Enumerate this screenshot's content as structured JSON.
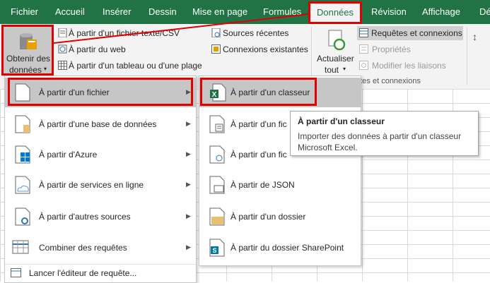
{
  "tabs": [
    "Fichier",
    "Accueil",
    "Insérer",
    "Dessin",
    "Mise en page",
    "Formules",
    "Données",
    "Révision",
    "Affichage",
    "Dév"
  ],
  "ribbon": {
    "obtenir_line1": "Obtenir des",
    "obtenir_line2": "données",
    "from_text_csv": "À partir d'un fichier texte/CSV",
    "from_web": "À partir du web",
    "from_table": "À partir d'un tableau ou d'une plage",
    "recent_sources": "Sources récentes",
    "existing_connections": "Connexions existantes",
    "refresh_line1": "Actualiser",
    "refresh_line2": "tout",
    "queries_connections": "Requêtes et connexions",
    "properties": "Propriétés",
    "edit_links": "Modifier les liaisons",
    "group_label": "uêtes et connexions"
  },
  "menu1": {
    "items": [
      {
        "label": "À partir d'un fichier"
      },
      {
        "label": "À partir d'une base de données"
      },
      {
        "label": "À partir d'Azure"
      },
      {
        "label": "À partir de services en ligne"
      },
      {
        "label": "À partir d'autres sources"
      },
      {
        "label": "Combiner des requêtes"
      }
    ],
    "footer": "Lancer l'éditeur de requête..."
  },
  "menu2": {
    "items": [
      {
        "label": "À partir d'un classeur"
      },
      {
        "label": "À partir d'un fic"
      },
      {
        "label": "À partir d'un fic"
      },
      {
        "label": "À partir de JSON"
      },
      {
        "label": "À partir d'un dossier"
      },
      {
        "label": "À partir du dossier SharePoint"
      }
    ]
  },
  "tooltip": {
    "title": "À partir d'un classeur",
    "body_line1": "Importer des données à partir d'un classeur",
    "body_line2": "Microsoft Excel."
  },
  "colors": {
    "ribbon_green": "#217346",
    "highlight_red": "#e00000",
    "menu_hover": "#c6c6c6"
  }
}
